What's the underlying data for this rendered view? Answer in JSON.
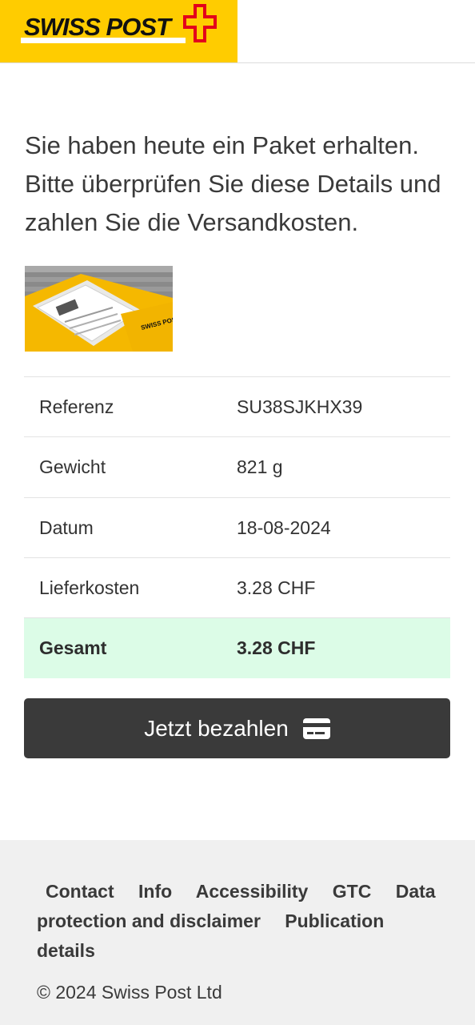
{
  "header": {
    "logo_text": "SWISS POST",
    "brand_color": "#ffcc00",
    "accent_color": "#e3001b"
  },
  "intro": {
    "text": "Sie haben heute ein Paket erhalten. Bitte überprüfen Sie diese Details und zahlen Sie die Versandkosten."
  },
  "parcel_image": {
    "label": "SWISS POST"
  },
  "details": {
    "rows": [
      {
        "label": "Referenz",
        "value": "SU38SJKHX39"
      },
      {
        "label": "Gewicht",
        "value": "821 g"
      },
      {
        "label": "Datum",
        "value": "18-08-2024"
      },
      {
        "label": "Lieferkosten",
        "value": "3.28 CHF"
      }
    ],
    "total": {
      "label": "Gesamt",
      "value": "3.28 CHF"
    },
    "total_highlight_color": "#dcfce7"
  },
  "pay_button": {
    "label": "Jetzt bezahlen",
    "icon": "credit-card-icon"
  },
  "footer": {
    "links": [
      "Contact",
      "Info",
      "Accessibility",
      "GTC",
      "Data protection and disclaimer",
      "Publication details"
    ],
    "copyright": "© 2024 Swiss Post Ltd"
  }
}
